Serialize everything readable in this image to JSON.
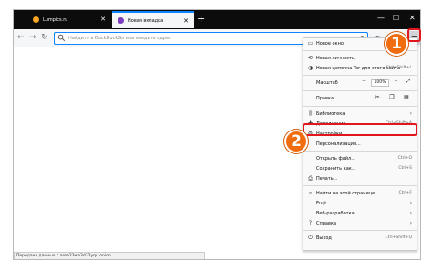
{
  "tabs": [
    {
      "label": "Lumpics.ru"
    },
    {
      "label": "Новая вкладка"
    }
  ],
  "newtab_symbol": "+",
  "urlbar": {
    "placeholder": "Найдите в DuckDuckGo или введите адрес"
  },
  "status_text": "Передача данных с area23wa3d32yqu.onion...",
  "menu": {
    "new_window": "Новое окно",
    "new_private": "Новая личность",
    "new_tor_circuit": "Новая цепочка Tor для этого сайта",
    "new_tor_circuit_shortcut": "Ctrl+Shift+L",
    "zoom_label": "Масштаб",
    "zoom_value": "100%",
    "edit_label": "Правка",
    "library": "Библиотека",
    "addons": "Дополнения",
    "addons_shortcut": "Ctrl+Shift+A",
    "settings": "Настройки",
    "customize": "Персонализация...",
    "open_file": "Открыть файл...",
    "open_file_shortcut": "Ctrl+O",
    "save_as": "Сохранить как...",
    "save_as_shortcut": "Ctrl+S",
    "print": "Печать...",
    "find": "Найти на этой странице...",
    "find_shortcut": "Ctrl+F",
    "more": "Ещё",
    "web_dev": "Веб-разработка",
    "help": "Справка",
    "exit": "Выход",
    "exit_shortcut": "Ctrl+Shift+Q"
  },
  "badges": {
    "one": "1",
    "two": "2"
  },
  "colors": {
    "highlight": "#e2161d",
    "badge": "#ef6c0f",
    "accent": "#0a84ff"
  }
}
